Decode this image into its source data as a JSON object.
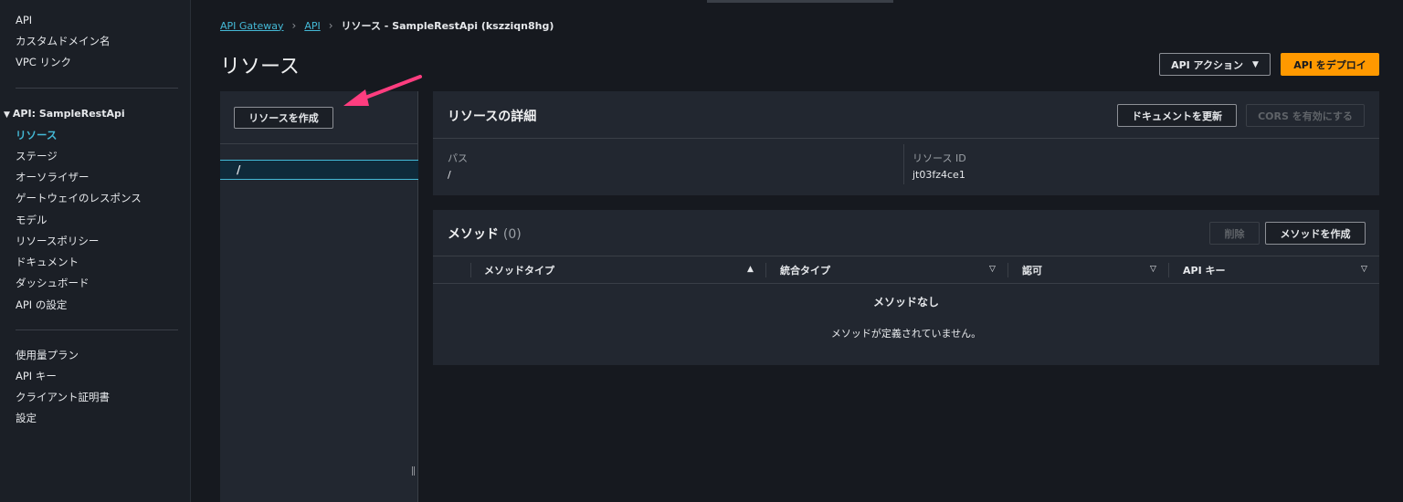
{
  "sidebar": {
    "top_items": [
      "API",
      "カスタムドメイン名",
      "VPC リンク"
    ],
    "section_title": "API: SampleRestApi",
    "api_items": [
      {
        "label": "リソース",
        "active": true
      },
      {
        "label": "ステージ"
      },
      {
        "label": "オーソライザー"
      },
      {
        "label": "ゲートウェイのレスポンス"
      },
      {
        "label": "モデル"
      },
      {
        "label": "リソースポリシー"
      },
      {
        "label": "ドキュメント"
      },
      {
        "label": "ダッシュボード"
      },
      {
        "label": "API の設定"
      }
    ],
    "bottom_items": [
      "使用量プラン",
      "API キー",
      "クライアント証明書",
      "設定"
    ]
  },
  "breadcrumb": {
    "items": [
      "API Gateway",
      "API"
    ],
    "current": "リソース - SampleRestApi (kszziqn8hg)"
  },
  "page": {
    "title": "リソース",
    "api_actions_label": "API アクション",
    "deploy_label": "API をデプロイ"
  },
  "tree": {
    "create_resource_label": "リソースを作成",
    "selected_path": "/"
  },
  "details": {
    "title": "リソースの詳細",
    "update_docs_label": "ドキュメントを更新",
    "enable_cors_label": "CORS を有効にする",
    "path_label": "パス",
    "path_value": "/",
    "resource_id_label": "リソース ID",
    "resource_id_value": "jt03fz4ce1"
  },
  "methods": {
    "title": "メソッド",
    "count": "(0)",
    "delete_label": "削除",
    "create_label": "メソッドを作成",
    "columns": [
      "メソッドタイプ",
      "統合タイプ",
      "認可",
      "API キー"
    ],
    "empty_title": "メソッドなし",
    "empty_desc": "メソッドが定義されていません。"
  },
  "colors": {
    "accent": "#44b9d6",
    "primary": "#ff9900",
    "annotation_arrow": "#ff3d7f"
  }
}
